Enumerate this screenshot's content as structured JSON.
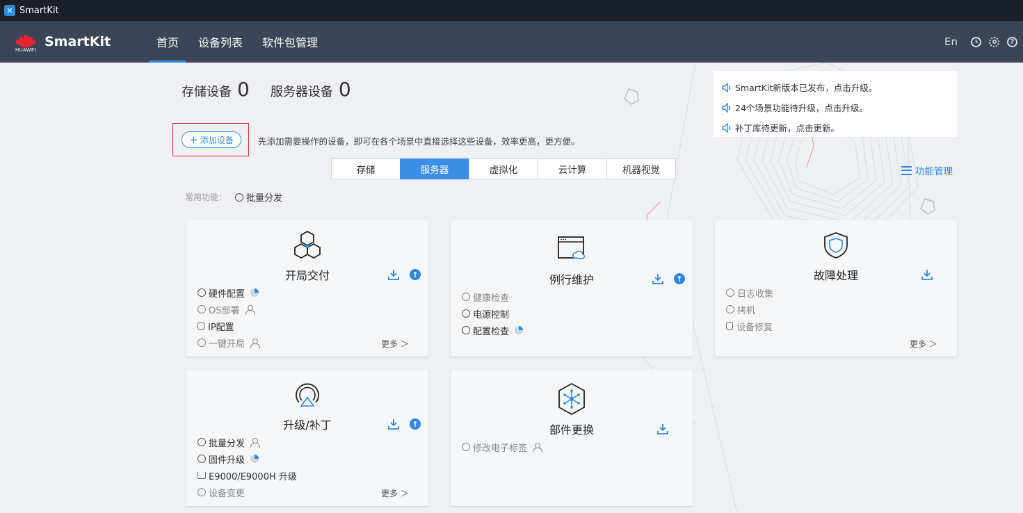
{
  "window": {
    "title": "SmartKit"
  },
  "header": {
    "brand_caption": "HUAWEI",
    "app_name": "SmartKit",
    "tabs": [
      "首页",
      "设备列表",
      "软件包管理"
    ],
    "active_tab": "首页",
    "lang": "En"
  },
  "counts": {
    "storage_label": "存储设备",
    "storage_count": "0",
    "server_label": "服务器设备",
    "server_count": "0"
  },
  "notices": [
    "SmartKit新版本已发布，点击升级。",
    "24个场景功能待升级，点击升级。",
    "补丁库待更新，点击更新。"
  ],
  "add_device": {
    "label": "添加设备",
    "hint": "先添加需要操作的设备，即可在各个场景中直接选择这些设备，效率更高，更方便。"
  },
  "categories": [
    "存储",
    "服务器",
    "虚拟化",
    "云计算",
    "机器视觉"
  ],
  "active_category": "服务器",
  "function_mgmt": "功能管理",
  "common": {
    "label": "常用功能：",
    "item": "批量分发"
  },
  "cards": [
    {
      "title": "开局交付",
      "items": [
        {
          "text": "硬件配置",
          "mark": "pie"
        },
        {
          "text": "OS部署",
          "mark": "user",
          "dim": true
        },
        {
          "text": "IP配置",
          "mark": "db"
        },
        {
          "text": "一键开局",
          "mark": "user",
          "dim": true
        }
      ],
      "more": "更多 ＞"
    },
    {
      "title": "例行维护",
      "items": [
        {
          "text": "健康检查",
          "dim": true
        },
        {
          "text": "电源控制"
        },
        {
          "text": "配置检查",
          "mark": "pie"
        }
      ]
    },
    {
      "title": "故障处理",
      "items": [
        {
          "text": "日志收集",
          "dim": true
        },
        {
          "text": "拷机",
          "dim": true
        },
        {
          "text": "设备修复",
          "mark": "db",
          "dim": true
        }
      ],
      "more": "更多 ＞"
    },
    {
      "title": "升级/补丁",
      "items": [
        {
          "text": "批量分发",
          "mark": "user"
        },
        {
          "text": "固件升级",
          "mark": "pie"
        },
        {
          "text": "E9000/E9000H 升级",
          "mark": "tray"
        },
        {
          "text": "设备变更",
          "dim": true
        }
      ],
      "more": "更多 ＞"
    },
    {
      "title": "部件更换",
      "items": [
        {
          "text": "修改电子标签",
          "mark": "user",
          "dim": true
        }
      ]
    }
  ],
  "colors": {
    "accent": "#3a8ee6",
    "header_bg": "#3c4457",
    "highlight_box": "#d9272e"
  }
}
